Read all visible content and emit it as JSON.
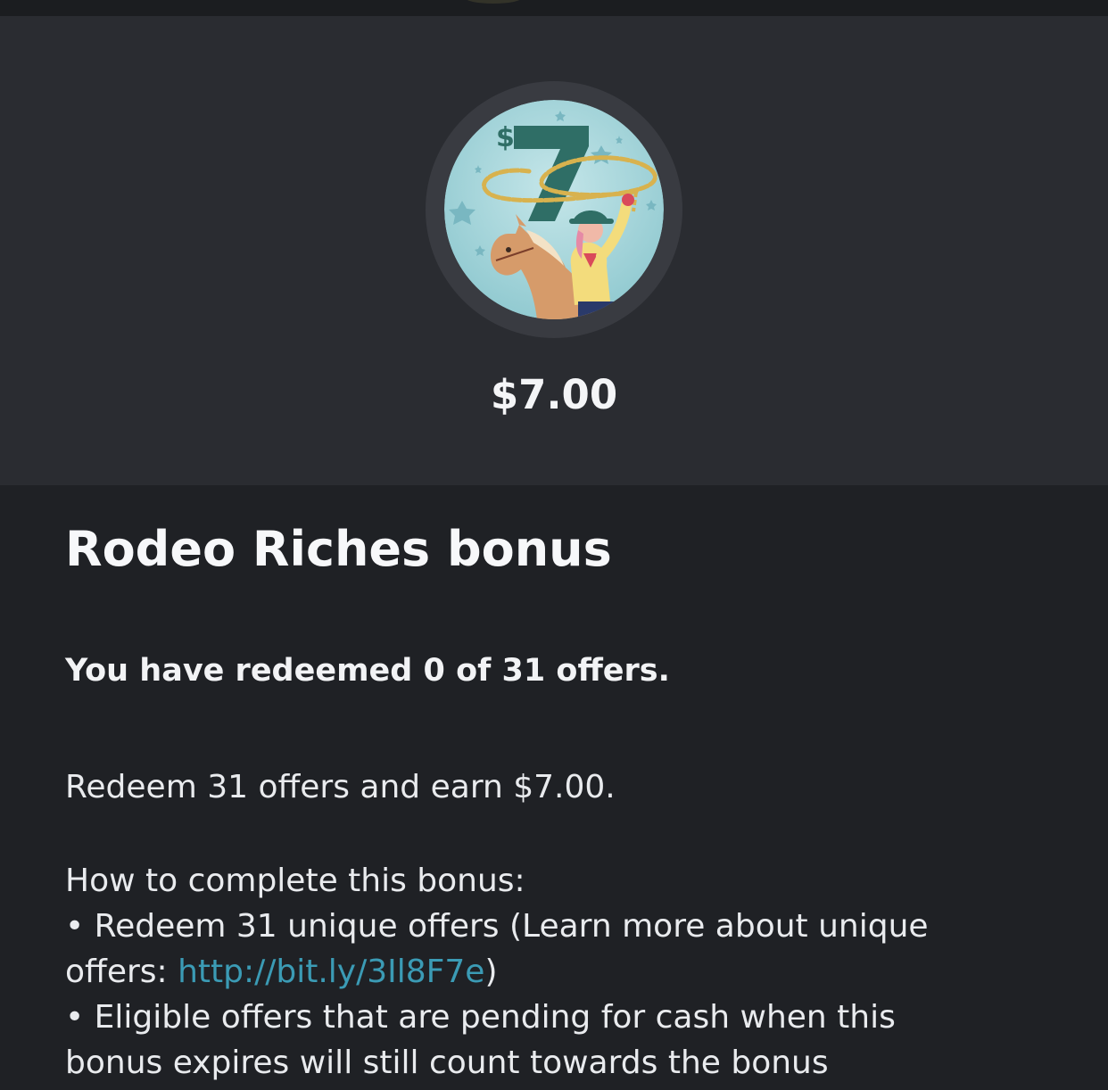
{
  "hero": {
    "badge_value_label": "$7",
    "amount": "$7.00"
  },
  "bonus": {
    "title": "Rodeo Riches bonus",
    "progress": "You have redeemed 0 of 31 offers.",
    "summary": "Redeem 31 offers and earn $7.00.",
    "howto_heading": "How to complete this bonus:",
    "rule1_prefix": "• Redeem 31 unique offers (Learn more about unique",
    "rule1_cont": "offers: ",
    "rule1_link": "http://bit.ly/3Il8F7e",
    "rule1_suffix": ")",
    "rule2_line1": "• Eligible offers that are pending for cash when this",
    "rule2_line2": "bonus expires will still count towards the bonus"
  },
  "colors": {
    "background": "#1f2125",
    "hero_background": "#2a2c31",
    "badge_ring": "#393b41",
    "badge_fill": "#a9d8dd",
    "badge_number": "#2f6e66",
    "link": "#3b9bb5"
  }
}
